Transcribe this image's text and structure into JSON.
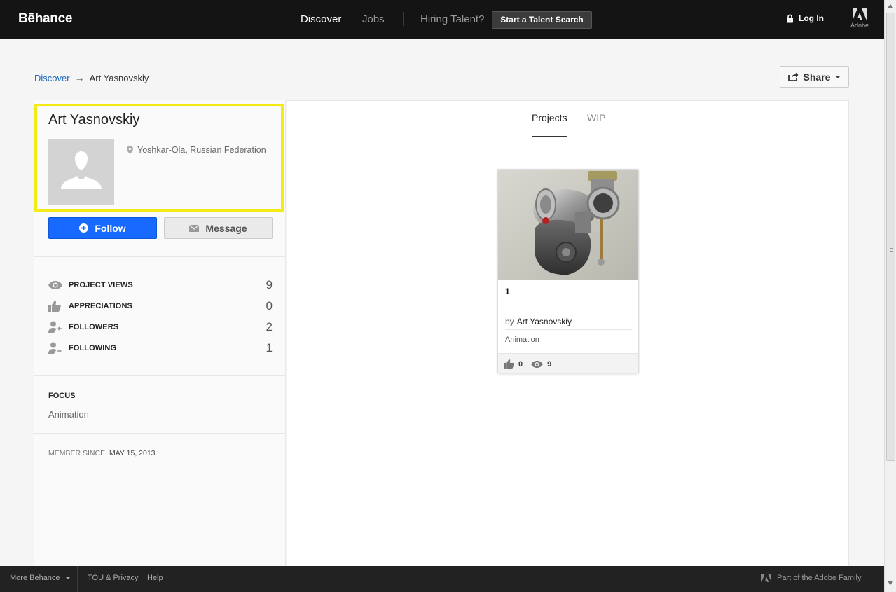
{
  "topbar": {
    "logo": "Bēhance",
    "discover": "Discover",
    "jobs": "Jobs",
    "hiring": "Hiring Talent?",
    "talent_search": "Start a Talent Search",
    "login": "Log In",
    "adobe": "Adobe"
  },
  "breadcrumb": {
    "root": "Discover",
    "arrow": "→",
    "current": "Art Yasnovskiy"
  },
  "share": {
    "label": "Share"
  },
  "profile": {
    "name": "Art Yasnovskiy",
    "location": "Yoshkar-Ola, Russian Federation",
    "follow_label": "Follow",
    "message_label": "Message"
  },
  "stats": [
    {
      "label": "PROJECT VIEWS",
      "value": "9",
      "icon": "eye-icon"
    },
    {
      "label": "APPRECIATIONS",
      "value": "0",
      "icon": "thumbs-up-icon"
    },
    {
      "label": "FOLLOWERS",
      "value": "2",
      "icon": "followers-icon"
    },
    {
      "label": "FOLLOWING",
      "value": "1",
      "icon": "following-icon"
    }
  ],
  "focus": {
    "label": "FOCUS",
    "value": "Animation"
  },
  "member": {
    "label": "MEMBER SINCE:",
    "date": "MAY 15, 2013"
  },
  "tabs": [
    {
      "label": "Projects",
      "active": true
    },
    {
      "label": "WIP",
      "active": false
    }
  ],
  "project": {
    "title": "1",
    "by": "by",
    "owner": "Art Yasnovskiy",
    "field": "Animation",
    "appreciations": "0",
    "views": "9"
  },
  "footer": {
    "more": "More Behance",
    "tou": "TOU & Privacy",
    "help": "Help",
    "adobe_family": "Part of the Adobe Family"
  },
  "colors": {
    "topbar": "#141414",
    "follow_blue": "#1769ff",
    "highlight": "#f5eb14",
    "link_blue": "#1a68c0"
  }
}
